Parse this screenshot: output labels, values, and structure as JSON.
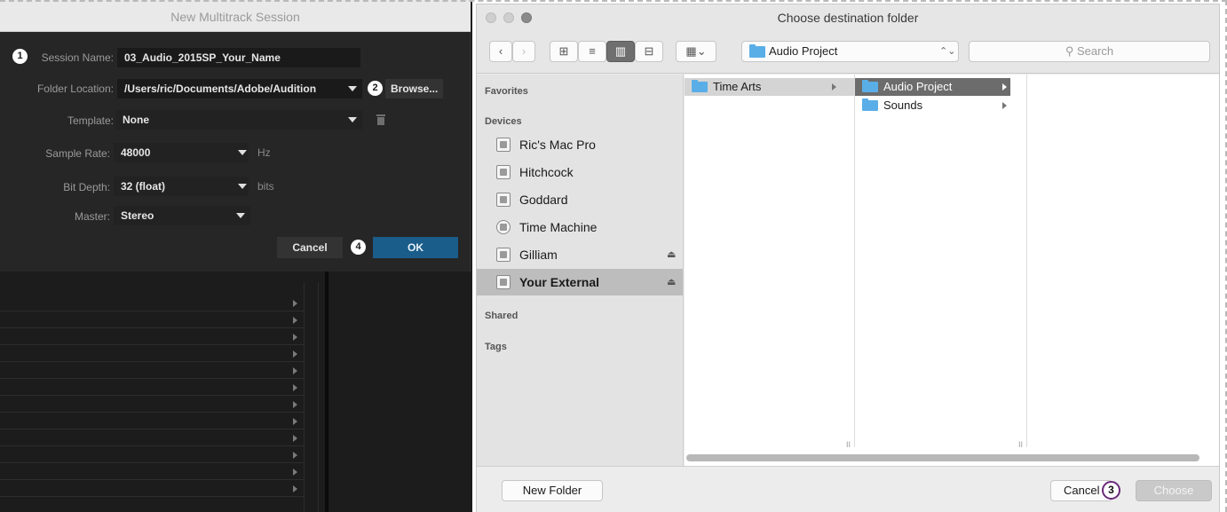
{
  "audition": {
    "title": "New Multitrack Session",
    "session_name_label": "Session Name:",
    "session_name_value": "03_Audio_2015SP_Your_Name",
    "folder_location_label": "Folder Location:",
    "folder_location_value": "/Users/ric/Documents/Adobe/Audition",
    "browse_label": "Browse...",
    "template_label": "Template:",
    "template_value": "None",
    "sample_rate_label": "Sample Rate:",
    "sample_rate_value": "48000",
    "sample_rate_unit": "Hz",
    "bit_depth_label": "Bit Depth:",
    "bit_depth_value": "32 (float)",
    "bit_depth_unit": "bits",
    "master_label": "Master:",
    "master_value": "Stereo",
    "cancel_label": "Cancel",
    "ok_label": "OK",
    "badges": [
      "1",
      "2",
      "4"
    ],
    "accent": "#1a5c8a"
  },
  "finder": {
    "title": "Choose destination folder",
    "path_popup": "Audio Project",
    "search_placeholder": "Search",
    "sidebar": {
      "favorites": "Favorites",
      "devices": "Devices",
      "shared": "Shared",
      "tags": "Tags",
      "device_items": [
        {
          "label": "Ric's Mac Pro",
          "icon": "computer-icon"
        },
        {
          "label": "Hitchcock",
          "icon": "drive-icon"
        },
        {
          "label": "Goddard",
          "icon": "drive-icon"
        },
        {
          "label": "Time Machine",
          "icon": "time-machine-icon"
        },
        {
          "label": "Gilliam",
          "icon": "drive-icon"
        },
        {
          "label": "Your External",
          "icon": "drive-icon"
        }
      ]
    },
    "columns": {
      "col1": [
        "Time Arts"
      ],
      "col2": [
        "Audio Project",
        "Sounds"
      ]
    },
    "new_folder_label": "New Folder",
    "cancel_label": "Cancel",
    "choose_label": "Choose",
    "badge": "3",
    "folder_color": "#5aaee7"
  }
}
